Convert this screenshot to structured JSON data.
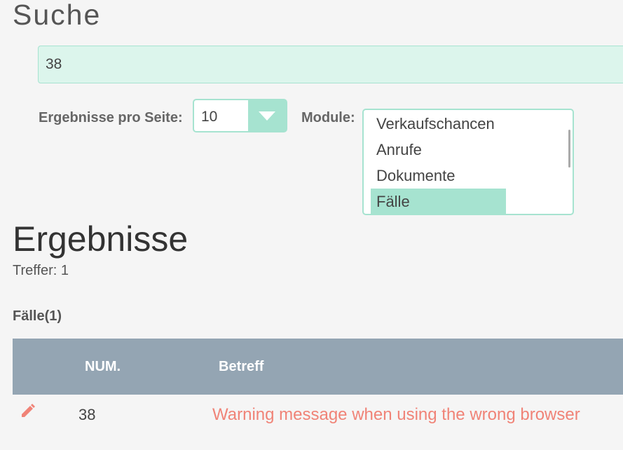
{
  "search": {
    "title": "Suche",
    "query": "38",
    "per_page_label": "Ergebnisse pro Seite:",
    "per_page_value": "10",
    "modules_label": "Module:",
    "modules": [
      "Verkaufschancen",
      "Anrufe",
      "Dokumente",
      "Fälle"
    ],
    "selected_module": "Fälle"
  },
  "results": {
    "heading": "Ergebnisse",
    "hits": "Treffer: 1",
    "section_title": "Fälle(1)",
    "columns": [
      "NUM.",
      "Betreff"
    ],
    "rows": [
      {
        "num": "38",
        "subject": "Warning message when using the wrong browser"
      }
    ]
  },
  "colors": {
    "accent": "#a6e3d0",
    "input_bg": "#dcf5ec",
    "table_header": "#94a5b3",
    "link": "#f08377"
  },
  "icons": {
    "row_action": "pencil-icon",
    "select_arrow": "chevron-down-icon"
  }
}
